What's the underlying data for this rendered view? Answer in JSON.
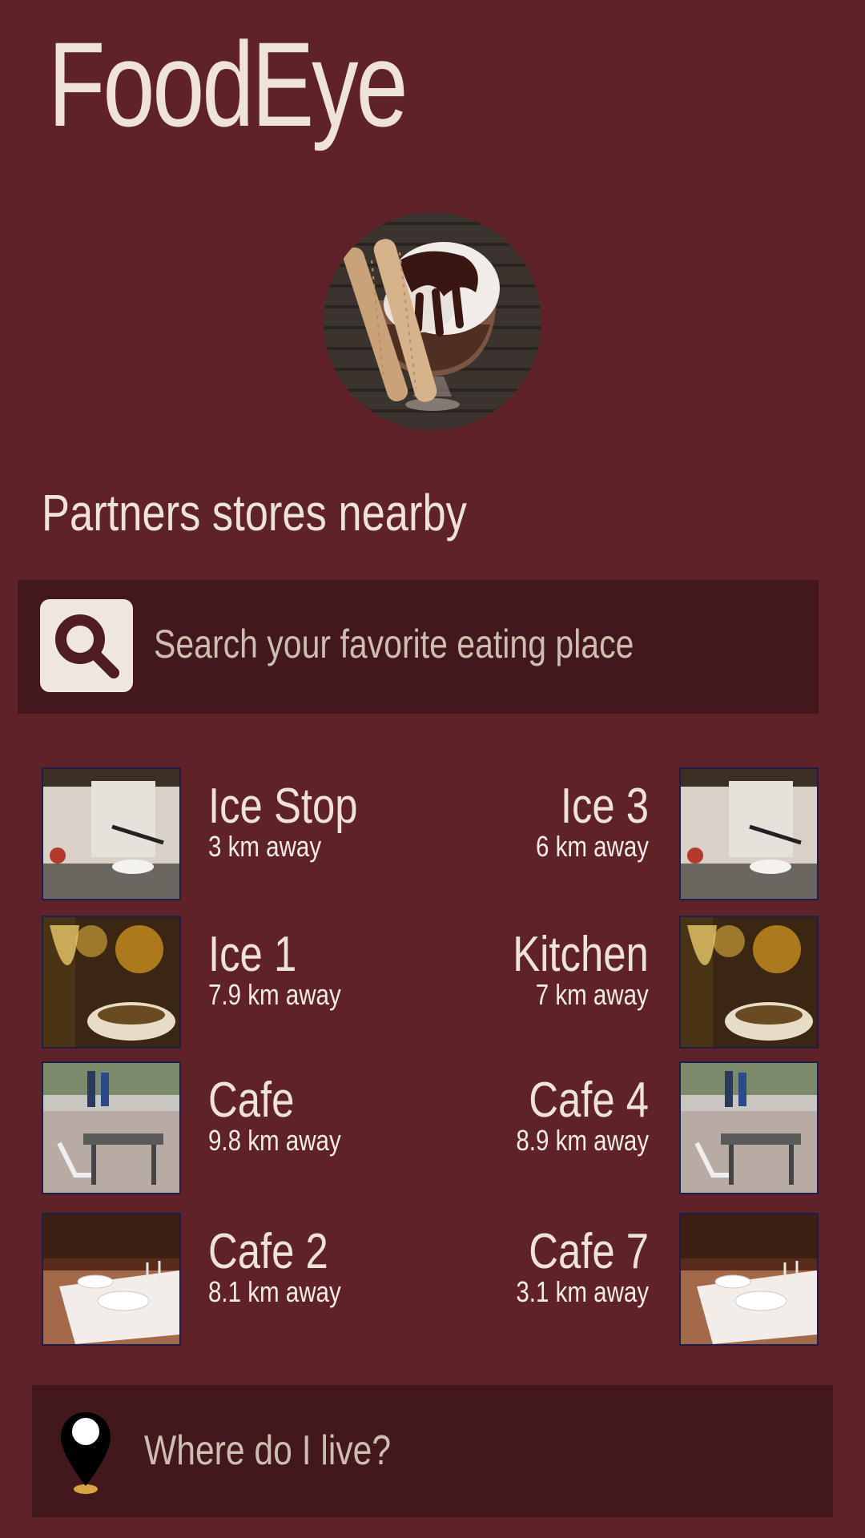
{
  "app": {
    "title": "FoodEye"
  },
  "hero": {
    "icon": "dessert-sundae-photo"
  },
  "section": {
    "title": "Partners stores nearby"
  },
  "search": {
    "icon": "search-icon",
    "placeholder": "Search your favorite eating place"
  },
  "stores": {
    "left": [
      {
        "name": "Ice Stop",
        "distance": "3 km away",
        "photo": "chef-cooking-photo"
      },
      {
        "name": "Ice 1",
        "distance": "7.9 km away",
        "photo": "wine-dinner-photo"
      },
      {
        "name": "Cafe",
        "distance": "9.8 km away",
        "photo": "street-cafe-photo"
      },
      {
        "name": "Cafe 2",
        "distance": "8.1 km away",
        "photo": "table-setting-photo"
      }
    ],
    "right": [
      {
        "name": "Ice 3",
        "distance": "6 km away",
        "photo": "chef-cooking-photo"
      },
      {
        "name": "Kitchen",
        "distance": "7 km away",
        "photo": "wine-dinner-photo"
      },
      {
        "name": "Cafe 4",
        "distance": "8.9 km away",
        "photo": "street-cafe-photo"
      },
      {
        "name": "Cafe 7",
        "distance": "3.1 km away",
        "photo": "table-setting-photo"
      }
    ]
  },
  "location": {
    "icon": "map-pin-icon",
    "label": "Where do I live?"
  },
  "colors": {
    "background": "#5e2228",
    "panel": "#43181c",
    "text": "#efe3d7",
    "thumb_border": "#1f1d4a"
  }
}
